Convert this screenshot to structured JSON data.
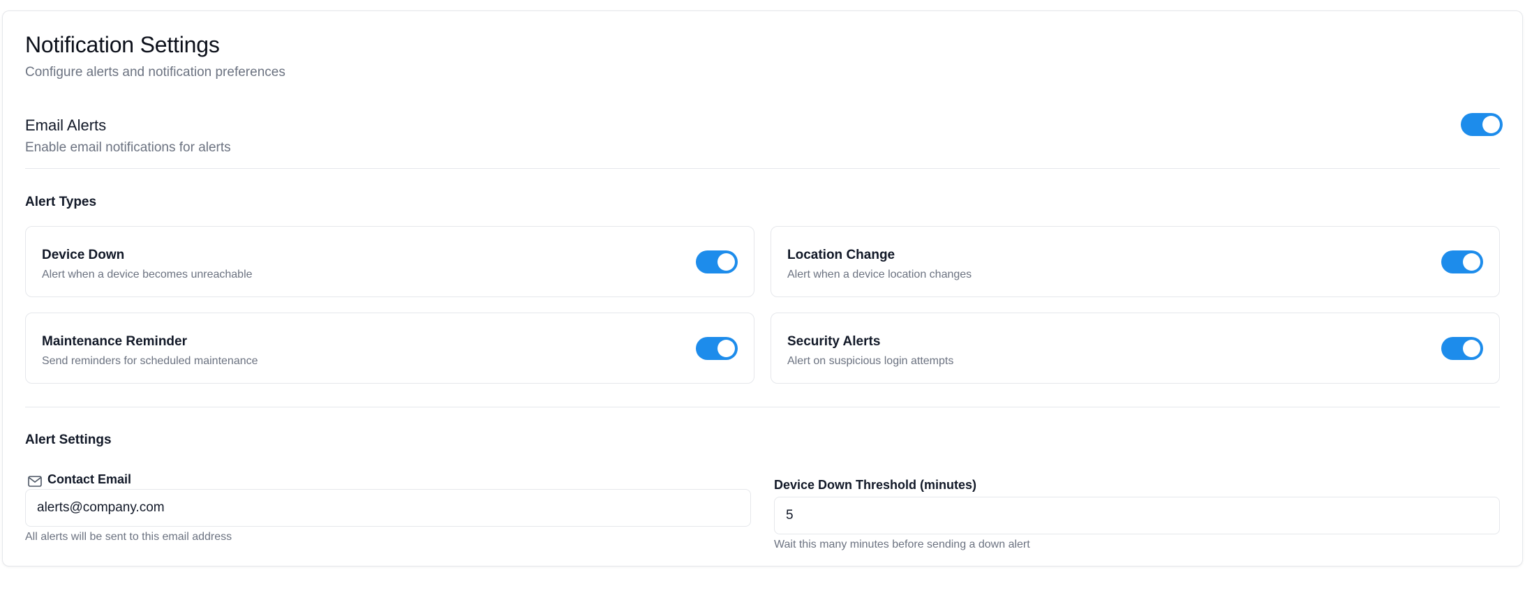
{
  "header": {
    "title": "Notification Settings",
    "subtitle": "Configure alerts and notification preferences"
  },
  "email_alerts": {
    "title": "Email Alerts",
    "description": "Enable email notifications for alerts",
    "enabled": true
  },
  "alert_types": {
    "heading": "Alert Types",
    "items": [
      {
        "title": "Device Down",
        "description": "Alert when a device becomes unreachable",
        "enabled": true
      },
      {
        "title": "Location Change",
        "description": "Alert when a device location changes",
        "enabled": true
      },
      {
        "title": "Maintenance Reminder",
        "description": "Send reminders for scheduled maintenance",
        "enabled": true
      },
      {
        "title": "Security Alerts",
        "description": "Alert on suspicious login attempts",
        "enabled": true
      }
    ]
  },
  "alert_settings": {
    "heading": "Alert Settings",
    "contact_email": {
      "label": "Contact Email",
      "value": "alerts@company.com",
      "helper": "All alerts will be sent to this email address",
      "icon": "mail-icon"
    },
    "threshold": {
      "label": "Device Down Threshold (minutes)",
      "value": "5",
      "helper": "Wait this many minutes before sending a down alert"
    }
  },
  "colors": {
    "accent": "#1d8ceb",
    "muted_text": "#6b7280",
    "border": "#e5e7eb"
  }
}
